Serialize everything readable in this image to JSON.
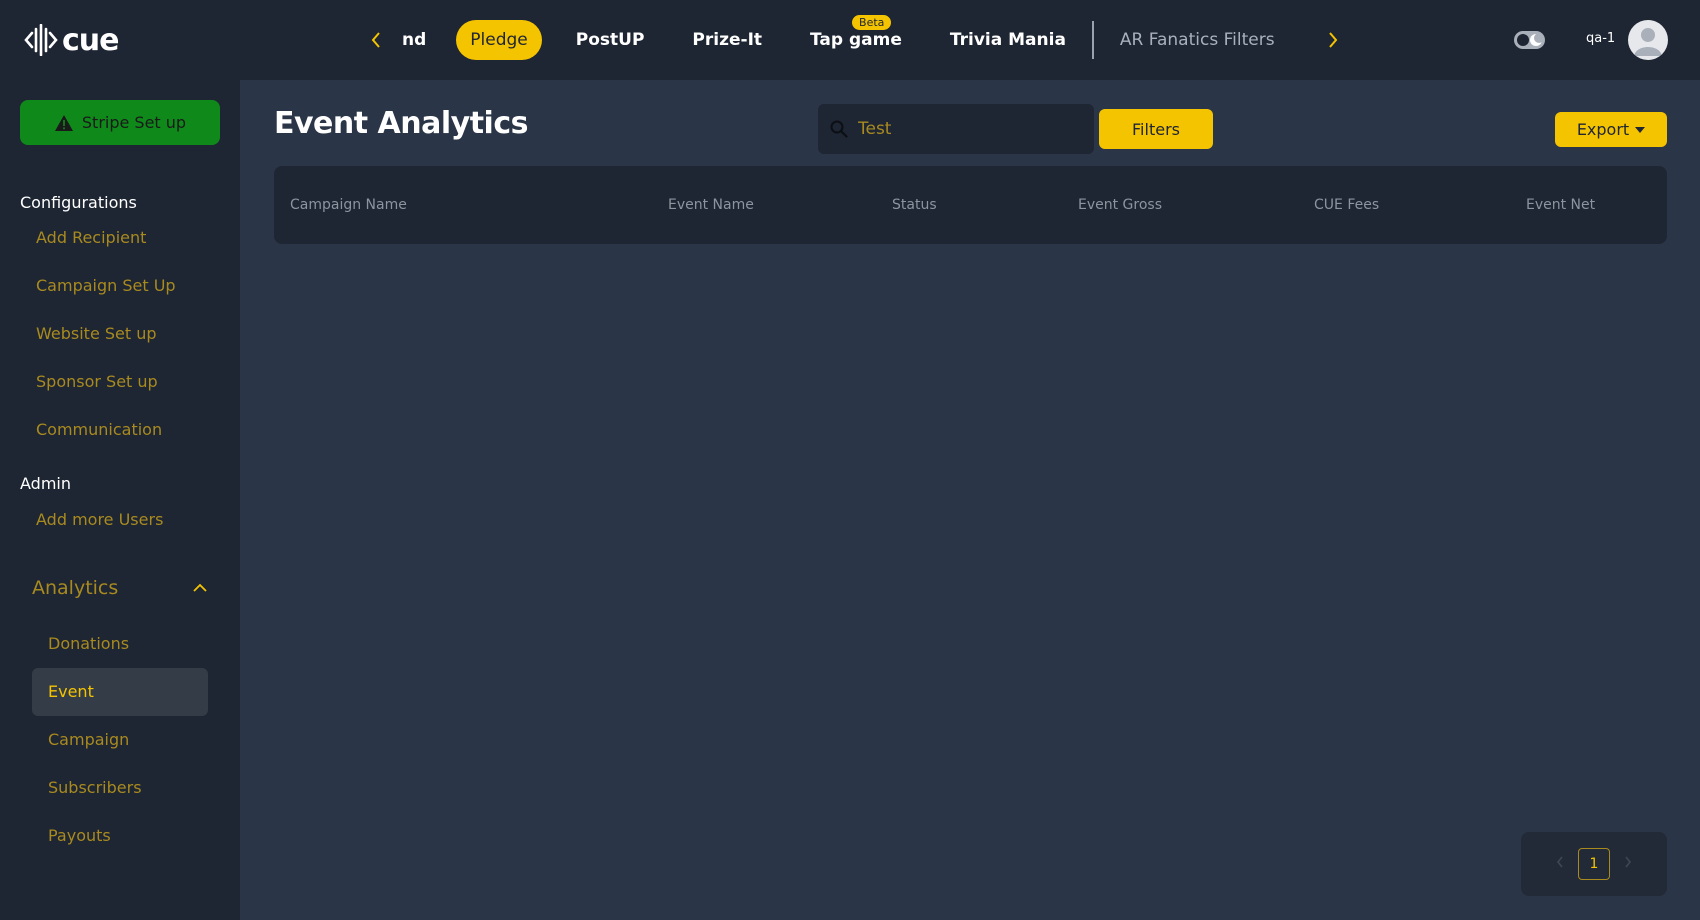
{
  "app": {
    "logo_text": "cue"
  },
  "nav": {
    "items": [
      {
        "label": "nd"
      },
      {
        "label": "Pledge"
      },
      {
        "label": "PostUP"
      },
      {
        "label": "Prize-It"
      },
      {
        "label": "Tap game",
        "badge": "Beta"
      },
      {
        "label": "Trivia Mania"
      },
      {
        "label": "AR Fanatics Filters"
      }
    ],
    "active": "Pledge"
  },
  "user": {
    "name": "qa-1"
  },
  "sidebar": {
    "stripe_button": "Stripe Set up",
    "configurations": {
      "heading": "Configurations",
      "items": [
        "Add Recipient",
        "Campaign Set Up",
        "Website Set up",
        "Sponsor Set up",
        "Communication"
      ]
    },
    "admin": {
      "heading": "Admin",
      "items": [
        "Add more Users"
      ]
    },
    "analytics": {
      "heading": "Analytics",
      "items": [
        "Donations",
        "Event",
        "Campaign",
        "Subscribers",
        "Payouts"
      ],
      "active": "Event"
    }
  },
  "main": {
    "title": "Event Analytics",
    "search": {
      "value": "Test"
    },
    "filters_label": "Filters",
    "export_label": "Export",
    "table": {
      "columns": [
        "Campaign Name",
        "Event Name",
        "Status",
        "Event Gross",
        "CUE Fees",
        "Event Net"
      ]
    },
    "pagination": {
      "current_page": "1"
    }
  },
  "colors": {
    "accent": "#f5c400",
    "link": "#a88a1f",
    "panel": "#1e2533",
    "background": "#2a3547",
    "stripe": "#0f8a1a"
  }
}
